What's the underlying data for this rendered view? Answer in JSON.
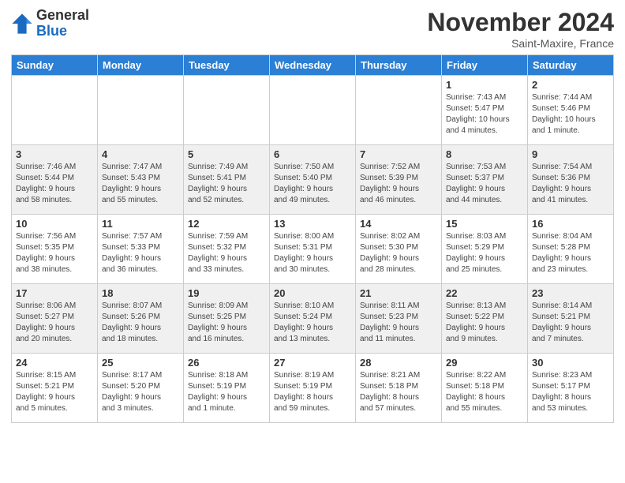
{
  "header": {
    "logo_general": "General",
    "logo_blue": "Blue",
    "month_title": "November 2024",
    "location": "Saint-Maxire, France"
  },
  "days_of_week": [
    "Sunday",
    "Monday",
    "Tuesday",
    "Wednesday",
    "Thursday",
    "Friday",
    "Saturday"
  ],
  "weeks": [
    [
      {
        "day": "",
        "info": ""
      },
      {
        "day": "",
        "info": ""
      },
      {
        "day": "",
        "info": ""
      },
      {
        "day": "",
        "info": ""
      },
      {
        "day": "",
        "info": ""
      },
      {
        "day": "1",
        "info": "Sunrise: 7:43 AM\nSunset: 5:47 PM\nDaylight: 10 hours\nand 4 minutes."
      },
      {
        "day": "2",
        "info": "Sunrise: 7:44 AM\nSunset: 5:46 PM\nDaylight: 10 hours\nand 1 minute."
      }
    ],
    [
      {
        "day": "3",
        "info": "Sunrise: 7:46 AM\nSunset: 5:44 PM\nDaylight: 9 hours\nand 58 minutes."
      },
      {
        "day": "4",
        "info": "Sunrise: 7:47 AM\nSunset: 5:43 PM\nDaylight: 9 hours\nand 55 minutes."
      },
      {
        "day": "5",
        "info": "Sunrise: 7:49 AM\nSunset: 5:41 PM\nDaylight: 9 hours\nand 52 minutes."
      },
      {
        "day": "6",
        "info": "Sunrise: 7:50 AM\nSunset: 5:40 PM\nDaylight: 9 hours\nand 49 minutes."
      },
      {
        "day": "7",
        "info": "Sunrise: 7:52 AM\nSunset: 5:39 PM\nDaylight: 9 hours\nand 46 minutes."
      },
      {
        "day": "8",
        "info": "Sunrise: 7:53 AM\nSunset: 5:37 PM\nDaylight: 9 hours\nand 44 minutes."
      },
      {
        "day": "9",
        "info": "Sunrise: 7:54 AM\nSunset: 5:36 PM\nDaylight: 9 hours\nand 41 minutes."
      }
    ],
    [
      {
        "day": "10",
        "info": "Sunrise: 7:56 AM\nSunset: 5:35 PM\nDaylight: 9 hours\nand 38 minutes."
      },
      {
        "day": "11",
        "info": "Sunrise: 7:57 AM\nSunset: 5:33 PM\nDaylight: 9 hours\nand 36 minutes."
      },
      {
        "day": "12",
        "info": "Sunrise: 7:59 AM\nSunset: 5:32 PM\nDaylight: 9 hours\nand 33 minutes."
      },
      {
        "day": "13",
        "info": "Sunrise: 8:00 AM\nSunset: 5:31 PM\nDaylight: 9 hours\nand 30 minutes."
      },
      {
        "day": "14",
        "info": "Sunrise: 8:02 AM\nSunset: 5:30 PM\nDaylight: 9 hours\nand 28 minutes."
      },
      {
        "day": "15",
        "info": "Sunrise: 8:03 AM\nSunset: 5:29 PM\nDaylight: 9 hours\nand 25 minutes."
      },
      {
        "day": "16",
        "info": "Sunrise: 8:04 AM\nSunset: 5:28 PM\nDaylight: 9 hours\nand 23 minutes."
      }
    ],
    [
      {
        "day": "17",
        "info": "Sunrise: 8:06 AM\nSunset: 5:27 PM\nDaylight: 9 hours\nand 20 minutes."
      },
      {
        "day": "18",
        "info": "Sunrise: 8:07 AM\nSunset: 5:26 PM\nDaylight: 9 hours\nand 18 minutes."
      },
      {
        "day": "19",
        "info": "Sunrise: 8:09 AM\nSunset: 5:25 PM\nDaylight: 9 hours\nand 16 minutes."
      },
      {
        "day": "20",
        "info": "Sunrise: 8:10 AM\nSunset: 5:24 PM\nDaylight: 9 hours\nand 13 minutes."
      },
      {
        "day": "21",
        "info": "Sunrise: 8:11 AM\nSunset: 5:23 PM\nDaylight: 9 hours\nand 11 minutes."
      },
      {
        "day": "22",
        "info": "Sunrise: 8:13 AM\nSunset: 5:22 PM\nDaylight: 9 hours\nand 9 minutes."
      },
      {
        "day": "23",
        "info": "Sunrise: 8:14 AM\nSunset: 5:21 PM\nDaylight: 9 hours\nand 7 minutes."
      }
    ],
    [
      {
        "day": "24",
        "info": "Sunrise: 8:15 AM\nSunset: 5:21 PM\nDaylight: 9 hours\nand 5 minutes."
      },
      {
        "day": "25",
        "info": "Sunrise: 8:17 AM\nSunset: 5:20 PM\nDaylight: 9 hours\nand 3 minutes."
      },
      {
        "day": "26",
        "info": "Sunrise: 8:18 AM\nSunset: 5:19 PM\nDaylight: 9 hours\nand 1 minute."
      },
      {
        "day": "27",
        "info": "Sunrise: 8:19 AM\nSunset: 5:19 PM\nDaylight: 8 hours\nand 59 minutes."
      },
      {
        "day": "28",
        "info": "Sunrise: 8:21 AM\nSunset: 5:18 PM\nDaylight: 8 hours\nand 57 minutes."
      },
      {
        "day": "29",
        "info": "Sunrise: 8:22 AM\nSunset: 5:18 PM\nDaylight: 8 hours\nand 55 minutes."
      },
      {
        "day": "30",
        "info": "Sunrise: 8:23 AM\nSunset: 5:17 PM\nDaylight: 8 hours\nand 53 minutes."
      }
    ]
  ]
}
